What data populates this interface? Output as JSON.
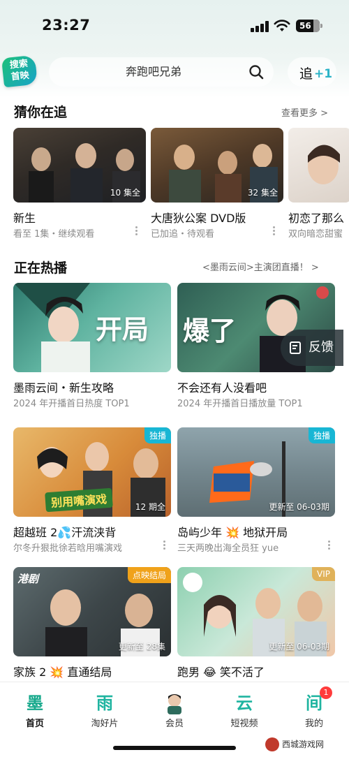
{
  "status_bar": {
    "time": "23:27",
    "battery": "56"
  },
  "header": {
    "logo_text": "搜索\n首映",
    "search_placeholder": "奔跑吧兄弟",
    "follow_label": "追",
    "follow_plus": "+1"
  },
  "guess": {
    "title": "猜你在追",
    "more": "查看更多 >",
    "items": [
      {
        "title": "新生",
        "sub": "看至 1集・继续观看",
        "badge": "10 集全"
      },
      {
        "title": "大唐狄公案 DVD版",
        "sub": "已加追・待观看",
        "badge": "32 集全"
      },
      {
        "title": "初恋了那么",
        "sub": "双向暗恋甜蜜",
        "badge": ""
      }
    ]
  },
  "hot": {
    "title": "正在热播",
    "more": "<墨雨云间>主演团直播！ >",
    "cards": [
      {
        "title": "墨雨云间・新生攻略",
        "sub": "2024 年开播首日热度 TOP1",
        "poster_text": "开局",
        "tag": "",
        "bottom": ""
      },
      {
        "title": "不会还有人没看吧",
        "sub": "2024 年开播首日播放量 TOP1",
        "poster_text": "爆了",
        "tag": "",
        "bottom": ""
      },
      {
        "title": "超越班 2💦汗流浃背",
        "sub": "尔冬升狠批徐若晗用嘴演戏",
        "poster_text": "别用嘴演戏",
        "tag": "独播",
        "bottom": "12 期全"
      },
      {
        "title": "岛屿少年 💥 地狱开局",
        "sub": "三天两晚出海全员狂 yue",
        "poster_text": "",
        "tag": "独播",
        "bottom": "更新至 06-03期"
      },
      {
        "title": "家族 2 💥 直通结局",
        "sub": "",
        "poster_text": "港剧",
        "tag": "点映结局",
        "bottom": "更新至 28集"
      },
      {
        "title": "跑男 😂 笑不活了",
        "sub": "",
        "poster_text": "",
        "tag": "VIP",
        "bottom": "更新至 06-03期"
      }
    ]
  },
  "feedback": {
    "label": "反馈"
  },
  "tabs": [
    {
      "icon": "墨",
      "label": "首页"
    },
    {
      "icon": "雨",
      "label": "淘好片"
    },
    {
      "icon": "",
      "label": "会员"
    },
    {
      "icon": "云",
      "label": "短视频"
    },
    {
      "icon": "间",
      "label": "我的",
      "badge": "1"
    }
  ],
  "watermark": "西城游戏网",
  "colors": {
    "accent": "#1fb4a0",
    "tag_exclusive": "#18b6d4",
    "tag_finale": "#f0a21a",
    "tag_vip": "#e0b25a",
    "badge_red": "#ff3b3b"
  }
}
